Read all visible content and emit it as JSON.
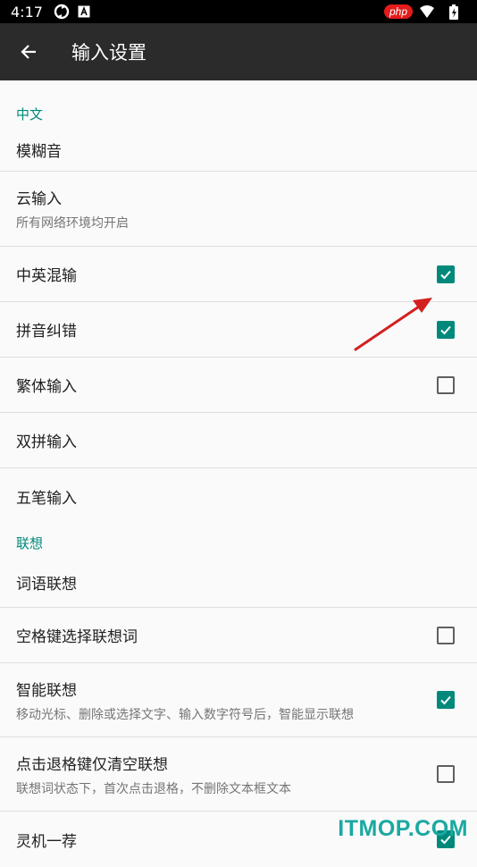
{
  "status_bar": {
    "time": "4:17",
    "icons": [
      "sync-icon",
      "a-notification-icon"
    ],
    "badge": "php",
    "right_icons": [
      "wifi-icon",
      "battery-icon"
    ]
  },
  "toolbar": {
    "back_icon": "arrow-back-icon",
    "title": "输入设置"
  },
  "sections": [
    {
      "header": "中文",
      "items": [
        {
          "title": "模糊音"
        },
        {
          "title": "云输入",
          "summary": "所有网络环境均开启"
        },
        {
          "title": "中英混输",
          "checked": true
        },
        {
          "title": "拼音纠错",
          "checked": true
        },
        {
          "title": "繁体输入",
          "checked": false
        },
        {
          "title": "双拼输入"
        },
        {
          "title": "五笔输入"
        }
      ]
    },
    {
      "header": "联想",
      "items": [
        {
          "title": "词语联想"
        },
        {
          "title": "空格键选择联想词",
          "checked": false
        },
        {
          "title": "智能联想",
          "summary": "移动光标、删除或选择文字、输入数字符号后，智能显示联想",
          "checked": true
        },
        {
          "title": "点击退格键仅清空联想",
          "summary": "联想词状态下，首次点击退格，不删除文本框文本",
          "checked": false
        },
        {
          "title": "灵机一荐",
          "checked": true
        }
      ]
    }
  ],
  "colors": {
    "accent": "#00897b",
    "toolbar": "#2b2b2b",
    "annotation_arrow": "#d32020"
  },
  "watermark": "ITMOP.COM"
}
